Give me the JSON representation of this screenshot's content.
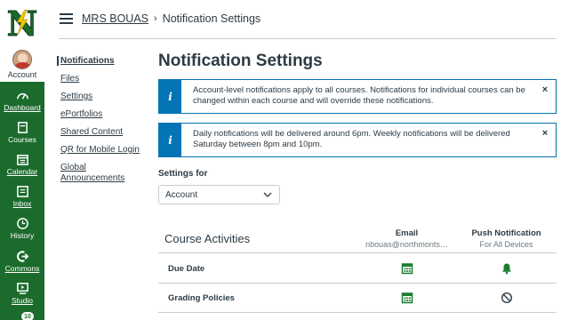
{
  "global_nav": {
    "logo_letter": "N",
    "account_label": "Account",
    "items": [
      {
        "label": "Dashboard",
        "icon": "dashboard-icon"
      },
      {
        "label": "Courses",
        "icon": "courses-icon"
      },
      {
        "label": "Calendar",
        "icon": "calendar-icon"
      },
      {
        "label": "Inbox",
        "icon": "inbox-icon"
      },
      {
        "label": "History",
        "icon": "history-icon"
      },
      {
        "label": "Commons",
        "icon": "commons-icon"
      },
      {
        "label": "Studio",
        "icon": "studio-icon"
      }
    ],
    "badge_count": "10"
  },
  "header": {
    "course": "MRS BOUAS",
    "separator": "›",
    "page": "Notification Settings"
  },
  "course_nav": [
    "Notifications",
    "Files",
    "Settings",
    "ePortfolios",
    "Shared Content",
    "QR for Mobile Login",
    "Global Announcements"
  ],
  "main": {
    "title": "Notification Settings",
    "alerts": [
      {
        "text": "Account-level notifications apply to all courses. Notifications for individual courses can be changed within each course and will override these notifications."
      },
      {
        "text": "Daily notifications will be delivered around 6pm. Weekly notifications will be delivered Saturday between 8pm and 10pm."
      }
    ],
    "info_glyph": "i",
    "close_glyph": "×",
    "settings_for_label": "Settings for",
    "settings_for_value": "Account",
    "section_title": "Course Activities",
    "columns": {
      "email_header": "Email",
      "email_sub": "nbouas@northmonts…",
      "push_header": "Push Notification",
      "push_sub": "For All Devices"
    },
    "rows": [
      {
        "name": "Due Date",
        "email": "daily-calendar-icon",
        "push": "bell-icon"
      },
      {
        "name": "Grading Policies",
        "email": "daily-calendar-icon",
        "push": "notifications-off-icon"
      }
    ]
  },
  "colors": {
    "brand_green": "#1b6b2c",
    "info_blue": "#0374b5",
    "logo_lightning": "#f2c500"
  }
}
